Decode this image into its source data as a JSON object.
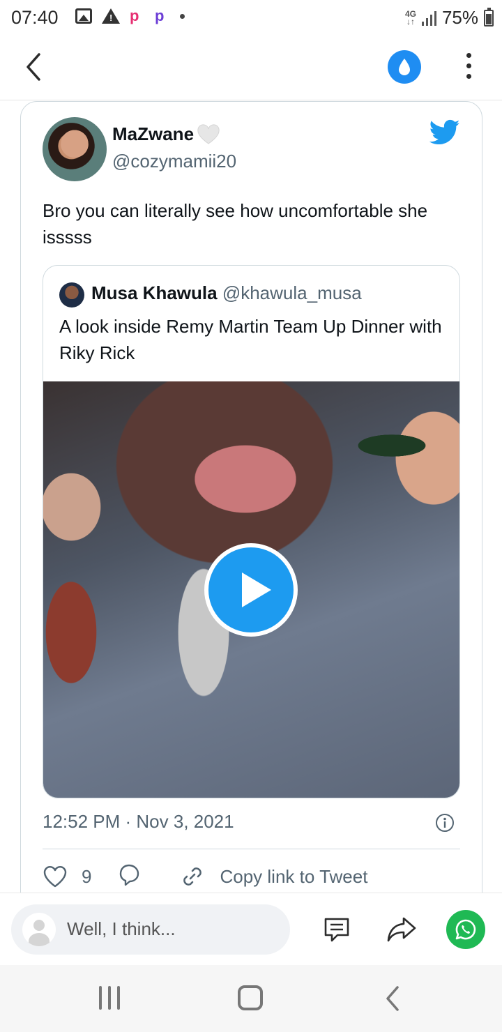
{
  "status_bar": {
    "time": "07:40",
    "network": "4G",
    "battery": "75%"
  },
  "tweet": {
    "author_name": "MaZwane",
    "author_handle": "@cozymamii20",
    "text": "Bro you can literally see how uncomfortable she isssss",
    "timestamp": "12:52 PM · Nov 3, 2021",
    "like_count": "9",
    "copy_link_label": "Copy link to Tweet"
  },
  "quoted_tweet": {
    "author_name": "Musa Khawula",
    "author_handle": "@khawula_musa",
    "text": "A look inside Remy Martin Team Up Dinner with Riky Rick"
  },
  "comment_bar": {
    "placeholder": "Well, I think..."
  },
  "colors": {
    "twitter_blue": "#1d9bf0",
    "whatsapp_green": "#1fb954",
    "drop_button_blue": "#1f8df2"
  }
}
